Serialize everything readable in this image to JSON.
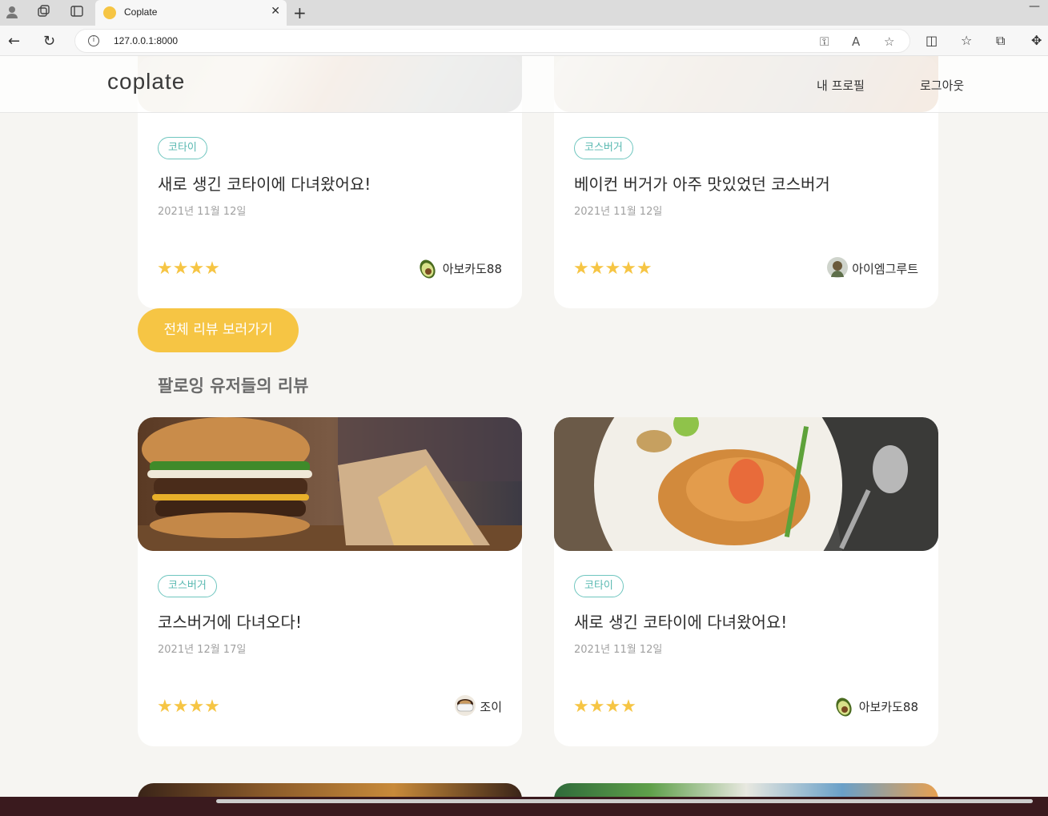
{
  "browser": {
    "tab_title": "Coplate",
    "url": "127.0.0.1:8000",
    "icons": [
      "profile-icon",
      "collections-icon",
      "tab-actions-icon",
      "back-icon",
      "refresh-icon",
      "info-icon",
      "key-icon",
      "read-aloud-icon",
      "favorite-icon",
      "split-screen-icon",
      "favorites-icon",
      "collections-icon",
      "extensions-icon"
    ]
  },
  "header": {
    "logo": "coplate",
    "nav": {
      "profile": "내 프로필",
      "logout": "로그아웃"
    }
  },
  "top_cards": [
    {
      "tag": "코타이",
      "title": "새로 생긴 코타이에 다녀왔어요!",
      "date": "2021년 11월 12일",
      "stars": "★★★★",
      "author": "아보카도88"
    },
    {
      "tag": "코스버거",
      "title": "베이컨 버거가 아주 맛있었던 코스버거",
      "date": "2021년 11월 12일",
      "stars": "★★★★★",
      "author": "아이엠그루트"
    }
  ],
  "buttons": {
    "all_reviews": "전체 리뷰 보러가기"
  },
  "section": {
    "following_title": "팔로잉 유저들의 리뷰"
  },
  "following_cards": [
    {
      "tag": "코스버거",
      "title": "코스버거에 다녀오다!",
      "date": "2021년 12월 17일",
      "stars": "★★★★",
      "author": "조이"
    },
    {
      "tag": "코타이",
      "title": "새로 생긴 코타이에 다녀왔어요!",
      "date": "2021년 11월 12일",
      "stars": "★★★★",
      "author": "아보카도88"
    }
  ],
  "colors": {
    "accent": "#f6c544",
    "tag": "#59b9b1",
    "background": "#f6f5f2"
  }
}
